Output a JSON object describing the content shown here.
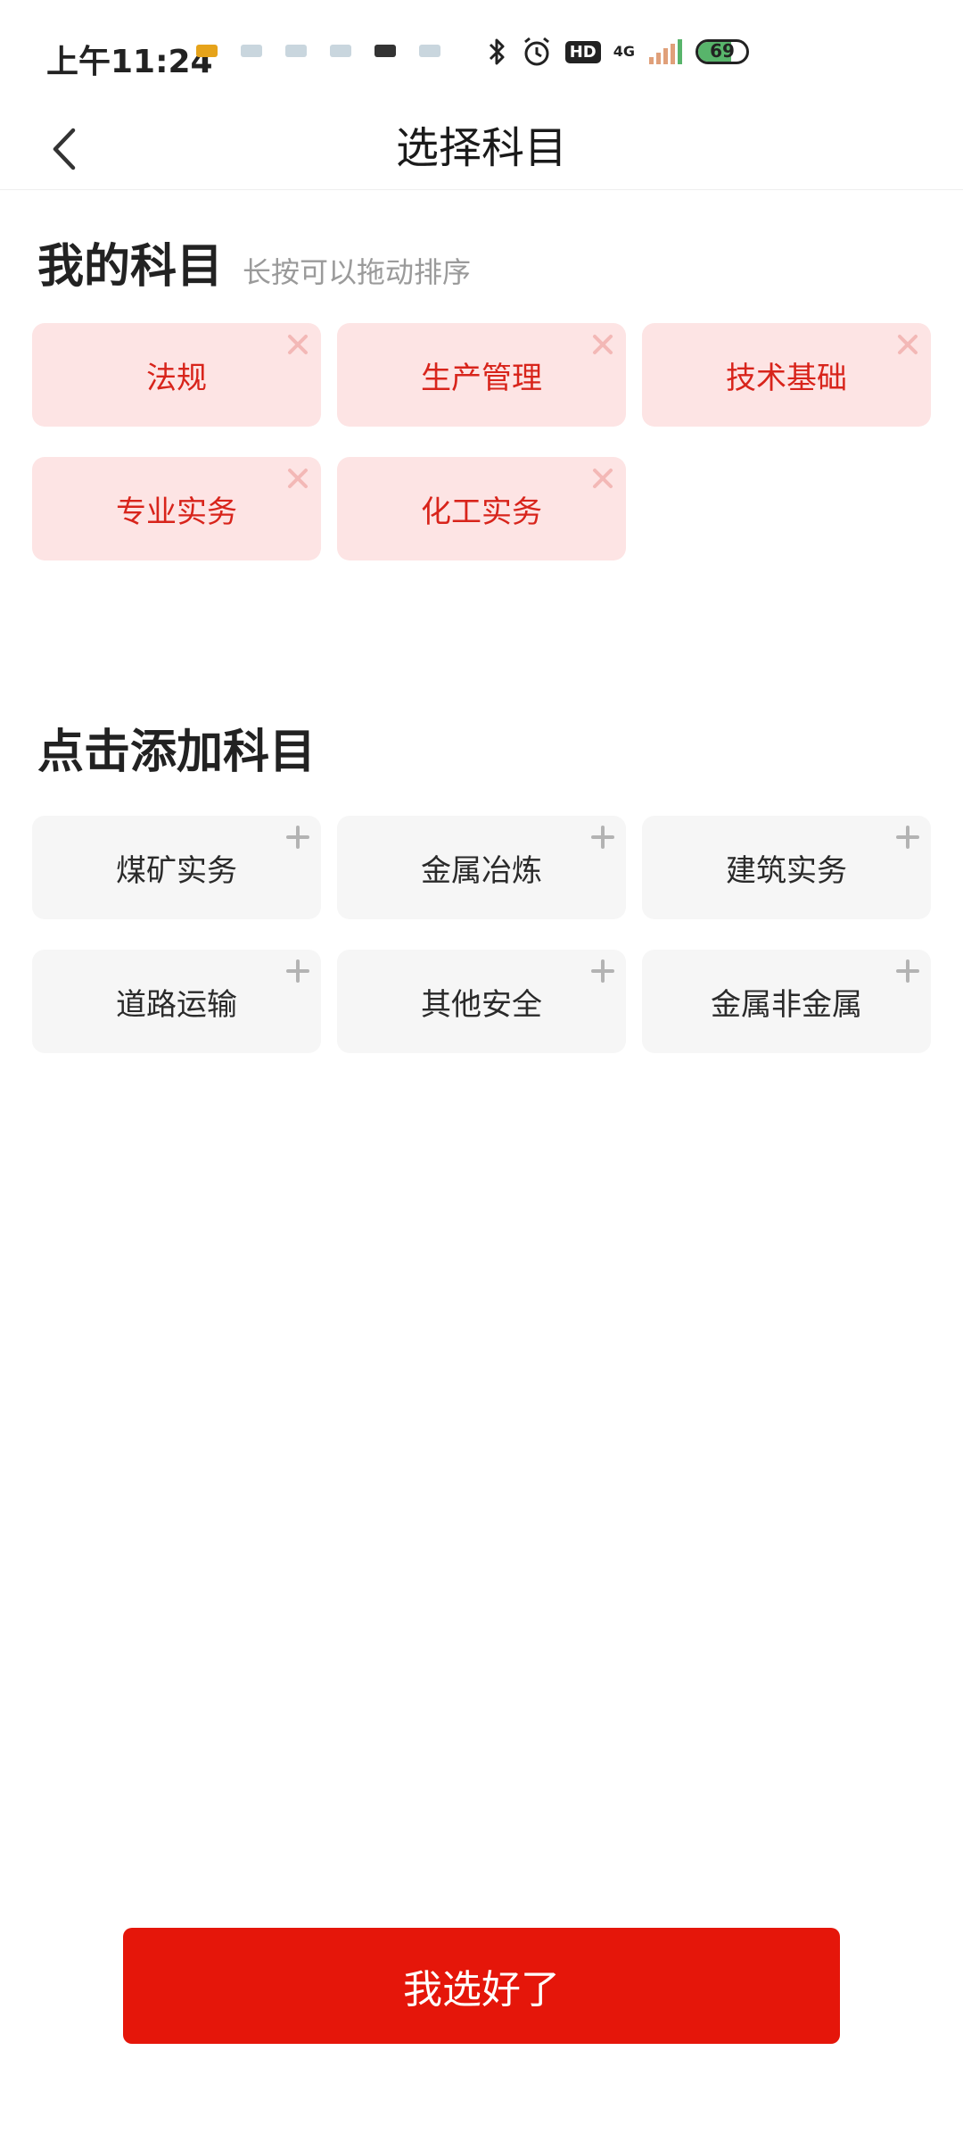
{
  "status_bar": {
    "time": "上午11:24",
    "hd": "HD",
    "network": "4G",
    "battery": "69",
    "battery_level": 0.69
  },
  "nav": {
    "title": "选择科目"
  },
  "my_subjects": {
    "title": "我的科目",
    "hint": "长按可以拖动排序",
    "items": [
      {
        "label": "法规"
      },
      {
        "label": "生产管理"
      },
      {
        "label": "技术基础"
      },
      {
        "label": "专业实务"
      },
      {
        "label": "化工实务"
      }
    ]
  },
  "add_subjects": {
    "title": "点击添加科目",
    "items": [
      {
        "label": "煤矿实务"
      },
      {
        "label": "金属冶炼"
      },
      {
        "label": "建筑实务"
      },
      {
        "label": "道路运输"
      },
      {
        "label": "其他安全"
      },
      {
        "label": "金属非金属"
      }
    ]
  },
  "confirm_button": {
    "label": "我选好了"
  },
  "colors": {
    "accent": "#e5160a",
    "mine_bg": "#fde4e4",
    "mine_text": "#d8241b",
    "available_bg": "#f6f6f6"
  }
}
